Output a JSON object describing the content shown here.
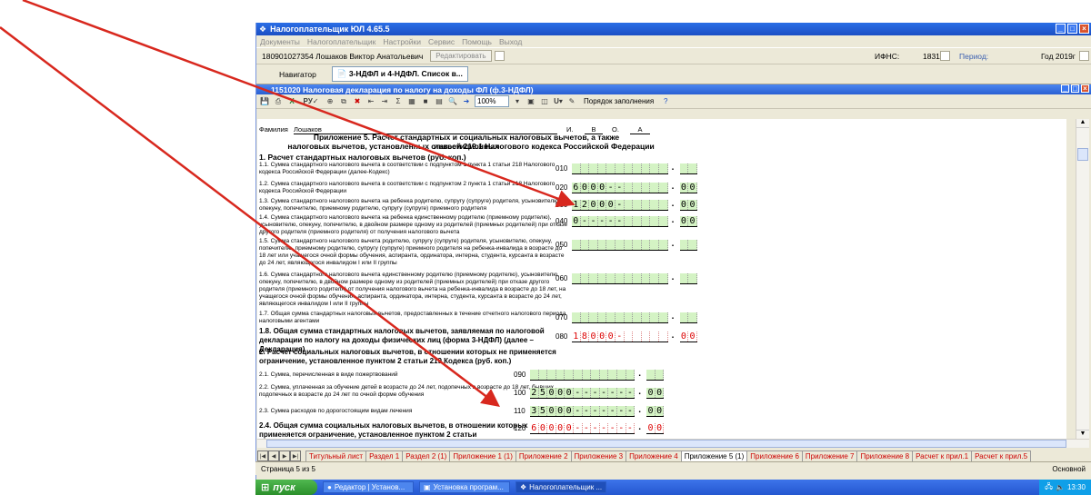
{
  "window": {
    "title": "Налогоплательщик ЮЛ 4.65.5"
  },
  "menu": [
    "Документы",
    "Налогоплательщик",
    "Настройки",
    "Сервис",
    "Помощь",
    "Выход"
  ],
  "info": {
    "taxpayer": "180901027354 Лошаков Виктор Анатольевич",
    "edit_label": "Редактировать",
    "ifns_label": "ИФНС:",
    "ifns_value": "1831",
    "period_label": "Период:",
    "period_value": "Год 2019г"
  },
  "nav": {
    "navigator": "Навигатор",
    "tab": "3-НДФЛ и 4-НДФЛ. Список в..."
  },
  "doc": {
    "title": "1151020 Налоговая декларация по налогу на доходы ФЛ (ф.3-НДФЛ)",
    "zoom": "100%",
    "order_label": "Порядок заполнения"
  },
  "form": {
    "surname_label": "Фамилия",
    "surname_value": "Лошаков",
    "initials_label_i": "И.",
    "initial_i": "В",
    "initials_label_o": "О.",
    "initial_o": "А",
    "heading_line1": "Приложение 5. Расчет стандартных и социальных налоговых вычетов, а также инвестиционных",
    "heading_line2": "налоговых вычетов, установленных статьей 219.1 Налогового кодекса Российской Федерации",
    "section1": "1. Расчет стандартных налоговых вычетов (руб. коп.)",
    "rows": [
      {
        "code": "010",
        "text": "1.1. Сумма стандартного налогового вычета в соответствии с подпунктом 1 пункта 1 статьи 218 Налогового кодекса Российской Федерации (далее-Кодекс)",
        "cells": [
          "",
          "",
          "",
          "",
          "",
          "",
          "",
          "",
          "",
          "",
          ""
        ],
        "kop": [
          "",
          ""
        ],
        "style": "green"
      },
      {
        "code": "020",
        "text": "1.2. Сумма стандартного налогового вычета в соответствии с подпунктом 2 пункта 1 статьи 218 Налогового кодекса Российской Федерации",
        "cells": [
          "6",
          "0",
          "0",
          "0",
          "-",
          "-"
        ],
        "kop": [
          "0",
          "0"
        ],
        "style": "green"
      },
      {
        "code": "030",
        "text": "1.3. Сумма стандартного налогового вычета на ребенка родителю, супругу (супруге) родителя, усыновителю, опекуну, попечителю, приемному родителю, супругу (супруге) приемного родителя",
        "cells": [
          "1",
          "2",
          "0",
          "0",
          "0",
          "-"
        ],
        "kop": [
          "0",
          "0"
        ],
        "style": "green"
      },
      {
        "code": "040",
        "text": "1.4. Сумма стандартного налогового вычета на ребенка единственному родителю (приемному родителю), усыновителю, опекуну, попечителю, в двойном размере одному из родителей (приемных родителей) при отказе другого родителя (приемного родителя) от получения налогового вычета",
        "cells": [
          "0",
          "-",
          "-",
          "-",
          "-",
          "-"
        ],
        "kop": [
          "0",
          "0"
        ],
        "style": "green"
      },
      {
        "code": "050",
        "text": "1.5. Сумма стандартного налогового вычета родителю, супругу (супруге) родителя, усыновителю, опекуну, попечителю, приемному родителю, супругу (супруге) приемного родителя на ребенка-инвалида в возрасте до 18 лет или учащегося очной формы обучения, аспиранта, ординатора, интерна, студента, курсанта в возрасте до 24 лет, являющегося инвалидом I или II группы",
        "cells": [
          "",
          "",
          "",
          "",
          "",
          ""
        ],
        "kop": [
          "",
          ""
        ],
        "style": "green"
      },
      {
        "code": "060",
        "text": "1.6. Сумма стандартного налогового вычета единственному родителю (приемному родителю), усыновителю, опекуну, попечителю, в двойном размере одному из родителей (приемных родителей) при отказе другого родителя (приемного родителя) от получения налогового вычета на ребенка-инвалида в возрасте до 18 лет, на учащегося очной формы обучения, аспиранта, ординатора, интерна, студента, курсанта в возрасте до 24 лет, являющегося инвалидом I или II группы",
        "cells": [
          "",
          "",
          "",
          "",
          "",
          ""
        ],
        "kop": [
          "",
          ""
        ],
        "style": "green"
      },
      {
        "code": "070",
        "text": "1.7. Общая сумма стандартных налоговых вычетов, предоставленных в течение отчетного налогового периода налоговыми агентами",
        "cells": [
          "",
          "",
          "",
          "",
          "",
          ""
        ],
        "kop": [
          "",
          ""
        ],
        "style": "green"
      }
    ],
    "row080": {
      "code": "080",
      "text": "1.8. Общая сумма стандартных налоговых вычетов, заявляемая по налоговой декларации по налогу на доходы физических лиц (форма 3-НДФЛ) (далее – Декларация)",
      "cells": [
        "1",
        "8",
        "0",
        "0",
        "0",
        "-"
      ],
      "kop": [
        "0",
        "0"
      ]
    },
    "section2": "2. Расчет социальных налоговых вычетов, в отношении которых не применяется ограничение, установленное пунктом 2 статьи 219 Кодекса (руб. коп.)",
    "rows2": [
      {
        "code": "090",
        "text": "2.1. Сумма, перечисленная в виде пожертвований",
        "cells": [
          "",
          "",
          "",
          "",
          "",
          "",
          "",
          "",
          "",
          "",
          "",
          ""
        ],
        "kop": [
          "",
          ""
        ]
      },
      {
        "code": "100",
        "text": "2.2. Сумма, уплаченная за обучение детей в возрасте до 24 лет, подопечных в возрасте до 18 лет, бывших подопечных в возрасте до 24 лет по очной форме обучения",
        "cells": [
          "2",
          "5",
          "0",
          "0",
          "0",
          "-",
          "-",
          "-",
          "-",
          "-",
          "-",
          "-"
        ],
        "kop": [
          "0",
          "0"
        ]
      },
      {
        "code": "110",
        "text": "2.3. Сумма расходов по дорогостоящим видам лечения",
        "cells": [
          "3",
          "5",
          "0",
          "0",
          "0",
          "-",
          "-",
          "-",
          "-",
          "-",
          "-",
          "-"
        ],
        "kop": [
          "0",
          "0"
        ]
      }
    ],
    "row120": {
      "code": "120",
      "text": "2.4. Общая сумма социальных налоговых вычетов, в отношении которых не применяется ограничение, установленное пунктом 2 статьи",
      "cells": [
        "6",
        "0",
        "0",
        "0",
        "0",
        "-",
        "-",
        "-",
        "-",
        "-",
        "-",
        "-"
      ],
      "kop": [
        "0",
        "0"
      ]
    }
  },
  "sheets": [
    {
      "label": "Титульный лист",
      "color": "red"
    },
    {
      "label": "Раздел 1",
      "color": "red"
    },
    {
      "label": "Раздел 2 (1)",
      "color": "red"
    },
    {
      "label": "Приложение 1 (1)",
      "color": "red"
    },
    {
      "label": "Приложение 2",
      "color": "red"
    },
    {
      "label": "Приложение 3",
      "color": "red"
    },
    {
      "label": "Приложение 4",
      "color": "red"
    },
    {
      "label": "Приложение 5 (1)",
      "color": "active"
    },
    {
      "label": "Приложение 6",
      "color": "red"
    },
    {
      "label": "Приложение 7",
      "color": "red"
    },
    {
      "label": "Приложение 8",
      "color": "red"
    },
    {
      "label": "Расчет к прил.1",
      "color": "red"
    },
    {
      "label": "Расчет к прил.5",
      "color": "red"
    }
  ],
  "status": {
    "page": "Страница 5 из 5",
    "mode": "Основной"
  },
  "taskbar": {
    "start": "пуск",
    "tasks": [
      "Редактор | Установ...",
      "Установка програм...",
      "Налогоплательщик ..."
    ],
    "time": "13:30"
  }
}
